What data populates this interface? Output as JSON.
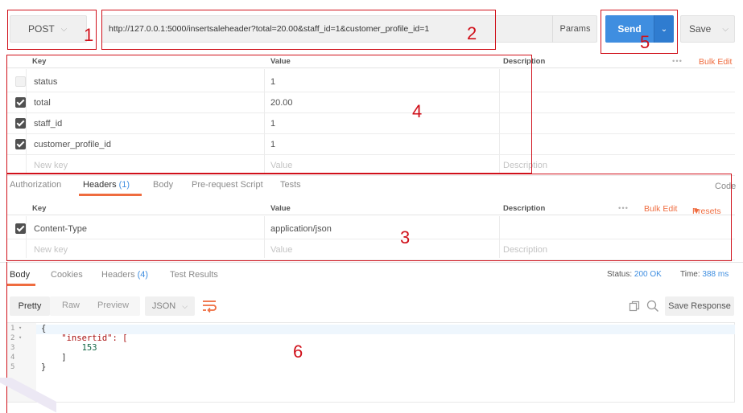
{
  "request": {
    "method": "POST",
    "url": "http://127.0.0.1:5000/insertsaleheader?total=20.00&staff_id=1&customer_profile_id=1",
    "params_label": "Params",
    "send_label": "Send",
    "save_label": "Save"
  },
  "params_table": {
    "headers": {
      "key": "Key",
      "value": "Value",
      "description": "Description"
    },
    "more": "•••",
    "bulk_edit": "Bulk Edit",
    "rows": [
      {
        "checked": false,
        "key": "status",
        "value": "1"
      },
      {
        "checked": true,
        "key": "total",
        "value": "20.00"
      },
      {
        "checked": true,
        "key": "staff_id",
        "value": "1"
      },
      {
        "checked": true,
        "key": "customer_profile_id",
        "value": "1"
      }
    ],
    "placeholder": {
      "key": "New key",
      "value": "Value",
      "description": "Description"
    }
  },
  "request_tabs": {
    "authorization": "Authorization",
    "headers": "Headers",
    "headers_count": "(1)",
    "body": "Body",
    "prerequest": "Pre-request Script",
    "tests": "Tests",
    "code": "Code"
  },
  "headers_table": {
    "headers": {
      "key": "Key",
      "value": "Value",
      "description": "Description"
    },
    "more": "•••",
    "bulk_edit": "Bulk Edit",
    "presets": "Presets",
    "rows": [
      {
        "checked": true,
        "key": "Content-Type",
        "value": "application/json"
      }
    ],
    "placeholder": {
      "key": "New key",
      "value": "Value",
      "description": "Description"
    }
  },
  "response_tabs": {
    "body": "Body",
    "cookies": "Cookies",
    "headers": "Headers",
    "headers_count": "(4)",
    "test_results": "Test Results",
    "status_label": "Status:",
    "status_value": "200 OK",
    "time_label": "Time:",
    "time_value": "388 ms"
  },
  "response_toolbar": {
    "pretty": "Pretty",
    "raw": "Raw",
    "preview": "Preview",
    "format": "JSON",
    "save_response": "Save Response"
  },
  "response_body": {
    "line_numbers": [
      "1",
      "2",
      "3",
      "4",
      "5"
    ],
    "lines": [
      "{",
      "    \"insertid\": [",
      "        153",
      "    ]",
      "}"
    ]
  },
  "annotations": [
    "1",
    "2",
    "3",
    "4",
    "5",
    "6"
  ],
  "colors": {
    "accent": "#ef6c3f",
    "send": "#3f8ee0",
    "annotation": "#d0101a",
    "status_ok": "#3f8ee0"
  }
}
